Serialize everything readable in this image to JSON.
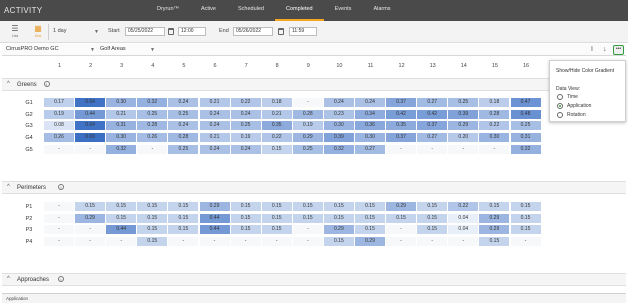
{
  "app_title": "ACTIVITY",
  "nav_tabs": [
    "Dryrun™",
    "Active",
    "Scheduled",
    "Completed",
    "Events",
    "Alarms"
  ],
  "nav_active": "Completed",
  "toolbar": {
    "list_label": "List",
    "grid_label": "Grid",
    "range_value": "1 day",
    "start_label": "Start",
    "start_date": "05/25/2022",
    "start_time": "12:00",
    "end_label": "End",
    "end_date": "05/26/2022",
    "end_time": "11:59"
  },
  "filters": {
    "site": "CirrusPRO Demo GC",
    "area": "Golf Areas"
  },
  "column_headers": [
    "1",
    "2",
    "3",
    "4",
    "5",
    "6",
    "7",
    "8",
    "9",
    "10",
    "11",
    "12",
    "13",
    "14",
    "15",
    "16"
  ],
  "color_scale": {
    "low": "#ffffff",
    "high": "#3b6fc4"
  },
  "sections": [
    {
      "title": "Greens",
      "rows": [
        {
          "label": "G1",
          "values": [
            "0.17",
            "0.64",
            "0.30",
            "0.32",
            "0.24",
            "0.21",
            "0.22",
            "0.18",
            "-",
            "0.24",
            "0.24",
            "0.37",
            "0.27",
            "0.25",
            "0.18",
            "0.47"
          ]
        },
        {
          "label": "G2",
          "values": [
            "0.19",
            "0.44",
            "0.21",
            "0.25",
            "0.25",
            "0.24",
            "0.24",
            "0.21",
            "0.28",
            "0.23",
            "0.34",
            "0.42",
            "0.42",
            "0.39",
            "0.28",
            "0.48"
          ]
        },
        {
          "label": "G3",
          "values": [
            "0.08",
            "0.64",
            "0.31",
            "0.28",
            "0.24",
            "0.24",
            "0.25",
            "0.35",
            "0.19",
            "0.30",
            "0.36",
            "0.35",
            "0.37",
            "0.29",
            "0.22",
            "0.25"
          ]
        },
        {
          "label": "G4",
          "values": [
            "0.26",
            "0.69",
            "0.30",
            "0.26",
            "0.28",
            "0.21",
            "0.19",
            "0.22",
            "0.29",
            "0.39",
            "0.30",
            "0.37",
            "0.27",
            "0.20",
            "0.30",
            "0.31"
          ]
        },
        {
          "label": "G5",
          "values": [
            "-",
            "-",
            "0.32",
            "-",
            "0.25",
            "0.24",
            "0.24",
            "0.15",
            "0.25",
            "0.32",
            "0.27",
            "-",
            "-",
            "-",
            "-",
            "0.32"
          ]
        }
      ]
    },
    {
      "title": "Perimeters",
      "rows": [
        {
          "label": "P1",
          "values": [
            "-",
            "0.15",
            "0.15",
            "0.15",
            "0.15",
            "0.29",
            "0.15",
            "0.15",
            "0.15",
            "0.15",
            "0.15",
            "0.29",
            "0.15",
            "0.22",
            "0.15",
            "0.15"
          ]
        },
        {
          "label": "P2",
          "values": [
            "-",
            "0.29",
            "0.15",
            "0.15",
            "0.15",
            "0.44",
            "0.15",
            "0.15",
            "0.15",
            "0.15",
            "0.15",
            "0.15",
            "0.15",
            "0.04",
            "0.29",
            "0.15"
          ]
        },
        {
          "label": "P3",
          "values": [
            "-",
            "-",
            "0.44",
            "0.15",
            "0.15",
            "0.44",
            "0.15",
            "0.15",
            "-",
            "0.29",
            "0.15",
            "-",
            "0.15",
            "0.04",
            "0.29",
            "0.15"
          ]
        },
        {
          "label": "P4",
          "values": [
            "-",
            "-",
            "-",
            "0.15",
            "-",
            "-",
            "-",
            "-",
            "-",
            "0.15",
            "0.29",
            "-",
            "-",
            "-",
            "0.15",
            "-"
          ]
        }
      ]
    },
    {
      "title": "Approaches",
      "rows": []
    }
  ],
  "popup": {
    "gradient_toggle": "Show/Hide Color Gradient",
    "data_view_label": "Data View:",
    "options": [
      "Time",
      "Application",
      "Rotation"
    ],
    "selected": "Application"
  },
  "status_text": "Application"
}
